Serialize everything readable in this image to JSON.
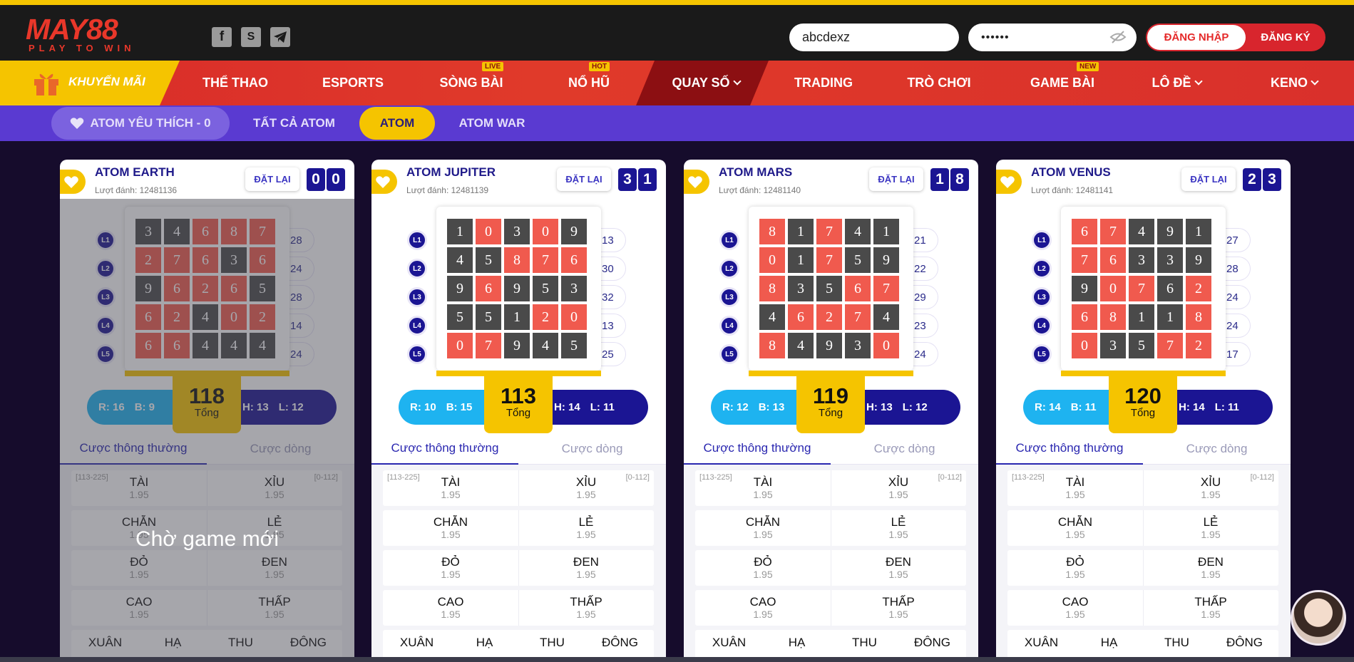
{
  "header": {
    "logo_big": "MAY88",
    "logo_small": "PLAY TO WIN",
    "social_icons": [
      "facebook-icon",
      "skype-icon",
      "telegram-icon"
    ],
    "username": "abcdexz",
    "password_mask": "••••••",
    "login_label": "ĐĂNG NHẬP",
    "register_label": "ĐĂNG KÝ"
  },
  "nav": {
    "promo": "KHUYẾN MÃI",
    "items": [
      {
        "label": "THỂ THAO",
        "badge": ""
      },
      {
        "label": "ESPORTS",
        "badge": ""
      },
      {
        "label": "SÒNG BÀI",
        "badge": "LIVE"
      },
      {
        "label": "NỔ HŨ",
        "badge": "HOT"
      },
      {
        "label": "QUAY SỐ",
        "badge": ""
      },
      {
        "label": "TRADING",
        "badge": ""
      },
      {
        "label": "TRÒ CHƠI",
        "badge": ""
      },
      {
        "label": "GAME BÀI",
        "badge": "NEW"
      },
      {
        "label": "LÔ ĐỀ",
        "badge": ""
      },
      {
        "label": "KENO",
        "badge": ""
      }
    ]
  },
  "subnav": {
    "favorite": "ATOM YÊU THÍCH - 0",
    "all": "TẤT CẢ ATOM",
    "atom": "ATOM",
    "war": "ATOM WAR"
  },
  "common": {
    "reset": "ĐẶT LẠI",
    "total_label": "Tổng",
    "tab_normal": "Cược thông thường",
    "tab_line": "Cược dòng",
    "row_labels": [
      "L1",
      "L2",
      "L3",
      "L4",
      "L5"
    ],
    "bets": [
      {
        "left": "TÀI",
        "right": "XỈU",
        "left_range": "[113-225]",
        "right_range": "[0-112]",
        "odds": "1.95"
      },
      {
        "left": "CHẴN",
        "right": "LẺ",
        "left_range": "",
        "right_range": "",
        "odds": "1.95"
      },
      {
        "left": "ĐỎ",
        "right": "ĐEN",
        "left_range": "",
        "right_range": "",
        "odds": "1.95"
      },
      {
        "left": "CAO",
        "right": "THẤP",
        "left_range": "",
        "right_range": "",
        "odds": "1.95"
      }
    ],
    "seasons": [
      "XUÂN",
      "HẠ",
      "THU",
      "ĐÔNG"
    ],
    "waiting": "Chờ game mới"
  },
  "colors": {
    "red": "#f05a4e",
    "black": "#4a4a4a",
    "accent": "#f5c400",
    "navy": "#1b1593",
    "blue": "#1eb3f0"
  },
  "cards": [
    {
      "name": "ATOM EARTH",
      "turn": "Lượt đánh: 12481136",
      "result": [
        "0",
        "0"
      ],
      "grid": [
        [
          "3",
          "4",
          "6",
          "8",
          "7"
        ],
        [
          "2",
          "7",
          "6",
          "3",
          "6"
        ],
        [
          "9",
          "6",
          "2",
          "6",
          "5"
        ],
        [
          "6",
          "2",
          "4",
          "0",
          "2"
        ],
        [
          "6",
          "6",
          "4",
          "4",
          "4"
        ]
      ],
      "colors": [
        [
          "k",
          "k",
          "r",
          "r",
          "r"
        ],
        [
          "r",
          "r",
          "r",
          "k",
          "r"
        ],
        [
          "k",
          "r",
          "r",
          "r",
          "k"
        ],
        [
          "r",
          "r",
          "k",
          "r",
          "r"
        ],
        [
          "r",
          "r",
          "k",
          "k",
          "k"
        ]
      ],
      "sums": [
        "28",
        "24",
        "28",
        "14",
        "24"
      ],
      "total": "118",
      "red": "R: 16",
      "black": "B: 9",
      "high": "H: 13",
      "low": "L: 12"
    },
    {
      "name": "ATOM JUPITER",
      "turn": "Lượt đánh: 12481139",
      "result": [
        "3",
        "1"
      ],
      "grid": [
        [
          "1",
          "0",
          "3",
          "0",
          "9"
        ],
        [
          "4",
          "5",
          "8",
          "7",
          "6"
        ],
        [
          "9",
          "6",
          "9",
          "5",
          "3"
        ],
        [
          "5",
          "5",
          "1",
          "2",
          "0"
        ],
        [
          "0",
          "7",
          "9",
          "4",
          "5"
        ]
      ],
      "colors": [
        [
          "k",
          "r",
          "k",
          "r",
          "k"
        ],
        [
          "k",
          "k",
          "r",
          "r",
          "r"
        ],
        [
          "k",
          "r",
          "k",
          "k",
          "k"
        ],
        [
          "k",
          "k",
          "k",
          "r",
          "r"
        ],
        [
          "r",
          "r",
          "k",
          "k",
          "k"
        ]
      ],
      "sums": [
        "13",
        "30",
        "32",
        "13",
        "25"
      ],
      "total": "113",
      "red": "R: 10",
      "black": "B: 15",
      "high": "H: 14",
      "low": "L: 11"
    },
    {
      "name": "ATOM MARS",
      "turn": "Lượt đánh: 12481140",
      "result": [
        "1",
        "8"
      ],
      "grid": [
        [
          "8",
          "1",
          "7",
          "4",
          "1"
        ],
        [
          "0",
          "1",
          "7",
          "5",
          "9"
        ],
        [
          "8",
          "3",
          "5",
          "6",
          "7"
        ],
        [
          "4",
          "6",
          "2",
          "7",
          "4"
        ],
        [
          "8",
          "4",
          "9",
          "3",
          "0"
        ]
      ],
      "colors": [
        [
          "r",
          "k",
          "r",
          "k",
          "k"
        ],
        [
          "r",
          "k",
          "r",
          "k",
          "k"
        ],
        [
          "r",
          "k",
          "k",
          "r",
          "r"
        ],
        [
          "k",
          "r",
          "r",
          "r",
          "k"
        ],
        [
          "r",
          "k",
          "k",
          "k",
          "r"
        ]
      ],
      "sums": [
        "21",
        "22",
        "29",
        "23",
        "24"
      ],
      "total": "119",
      "red": "R: 12",
      "black": "B: 13",
      "high": "H: 13",
      "low": "L: 12"
    },
    {
      "name": "ATOM VENUS",
      "turn": "Lượt đánh: 12481141",
      "result": [
        "2",
        "3"
      ],
      "grid": [
        [
          "6",
          "7",
          "4",
          "9",
          "1"
        ],
        [
          "7",
          "6",
          "3",
          "3",
          "9"
        ],
        [
          "9",
          "0",
          "7",
          "6",
          "2"
        ],
        [
          "6",
          "8",
          "1",
          "1",
          "8"
        ],
        [
          "0",
          "3",
          "5",
          "7",
          "2"
        ]
      ],
      "colors": [
        [
          "r",
          "r",
          "k",
          "k",
          "k"
        ],
        [
          "r",
          "r",
          "k",
          "k",
          "k"
        ],
        [
          "k",
          "r",
          "r",
          "k",
          "r"
        ],
        [
          "r",
          "r",
          "k",
          "k",
          "r"
        ],
        [
          "r",
          "k",
          "k",
          "r",
          "r"
        ]
      ],
      "sums": [
        "27",
        "28",
        "24",
        "24",
        "17"
      ],
      "total": "120",
      "red": "R: 14",
      "black": "B: 11",
      "high": "H: 14",
      "low": "L: 11"
    }
  ]
}
